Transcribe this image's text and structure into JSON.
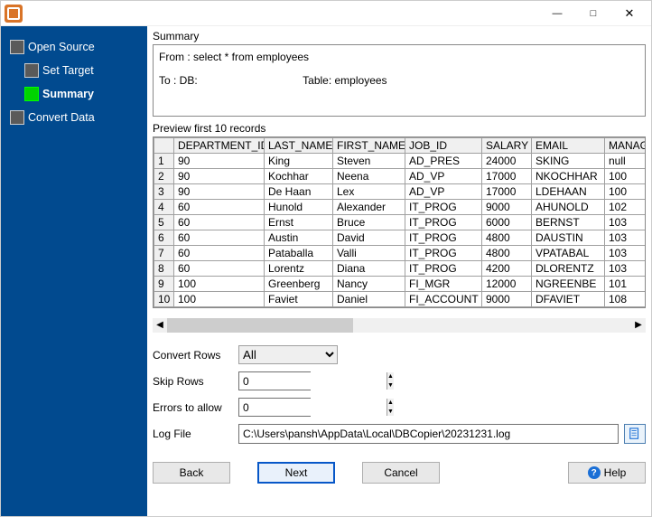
{
  "sidebar": {
    "items": [
      {
        "label": "Open Source"
      },
      {
        "label": "Set Target"
      },
      {
        "label": "Summary"
      },
      {
        "label": "Convert Data"
      }
    ]
  },
  "summary": {
    "heading": "Summary",
    "from": "From : select * from employees",
    "to_db": "To : DB:",
    "to_table_lbl": "Table: employees"
  },
  "preview": {
    "heading": "Preview first 10 records",
    "columns": [
      "DEPARTMENT_ID",
      "LAST_NAME",
      "FIRST_NAME",
      "JOB_ID",
      "SALARY",
      "EMAIL",
      "MANAG"
    ],
    "rows": [
      [
        "90",
        "King",
        "Steven",
        "AD_PRES",
        "24000",
        "SKING",
        "null"
      ],
      [
        "90",
        "Kochhar",
        "Neena",
        "AD_VP",
        "17000",
        "NKOCHHAR",
        "100"
      ],
      [
        "90",
        "De Haan",
        "Lex",
        "AD_VP",
        "17000",
        "LDEHAAN",
        "100"
      ],
      [
        "60",
        "Hunold",
        "Alexander",
        "IT_PROG",
        "9000",
        "AHUNOLD",
        "102"
      ],
      [
        "60",
        "Ernst",
        "Bruce",
        "IT_PROG",
        "6000",
        "BERNST",
        "103"
      ],
      [
        "60",
        "Austin",
        "David",
        "IT_PROG",
        "4800",
        "DAUSTIN",
        "103"
      ],
      [
        "60",
        "Pataballa",
        "Valli",
        "IT_PROG",
        "4800",
        "VPATABAL",
        "103"
      ],
      [
        "60",
        "Lorentz",
        "Diana",
        "IT_PROG",
        "4200",
        "DLORENTZ",
        "103"
      ],
      [
        "100",
        "Greenberg",
        "Nancy",
        "FI_MGR",
        "12000",
        "NGREENBE",
        "101"
      ],
      [
        "100",
        "Faviet",
        "Daniel",
        "FI_ACCOUNT",
        "9000",
        "DFAVIET",
        "108"
      ]
    ]
  },
  "options": {
    "convert_rows_label": "Convert Rows",
    "convert_rows_value": "All",
    "skip_rows_label": "Skip Rows",
    "skip_rows_value": "0",
    "errors_label": "Errors to allow",
    "errors_value": "0",
    "log_label": "Log File",
    "log_value": "C:\\Users\\pansh\\AppData\\Local\\DBCopier\\20231231.log"
  },
  "buttons": {
    "back": "Back",
    "next": "Next",
    "cancel": "Cancel",
    "help": "Help"
  }
}
